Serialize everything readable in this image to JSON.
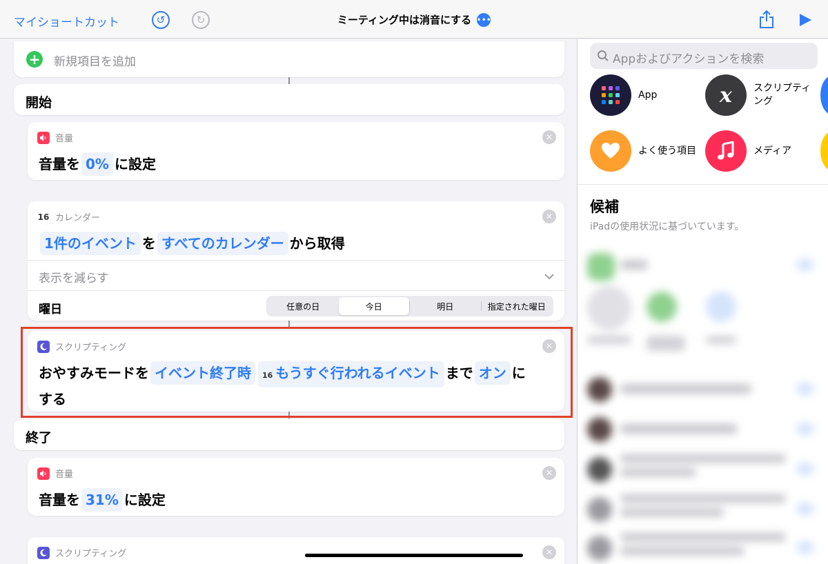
{
  "nav": {
    "back_label": "マイショートカット",
    "title": "ミーティング中は消音にする",
    "more_glyph": "•••",
    "undo_glyph": "↺",
    "redo_glyph": "↻",
    "icons": [
      "undo-icon",
      "redo-icon",
      "share-icon",
      "play-icon"
    ]
  },
  "editor": {
    "add_item_label": "新規項目を追加",
    "start_label": "開始",
    "end_label": "終了",
    "volume1": {
      "action_name": "音量",
      "prefix": "音量を",
      "value": "0%",
      "suffix": "に設定"
    },
    "calendar": {
      "badge": "16",
      "action_name": "カレンダー",
      "token1": "1件のイベント",
      "connector": "を",
      "token2": "すべてのカレンダー",
      "suffix": "から取得",
      "show_less": "表示を減らす",
      "weekday_label": "曜日",
      "segments": [
        "任意の日",
        "今日",
        "明日",
        "指定された曜日"
      ],
      "selected_segment": "今日"
    },
    "scripting1": {
      "action_name": "スクリプティング",
      "prefix": "おやすみモードを",
      "token1": "イベント終了時",
      "token2_badge": "16",
      "token2": "もうすぐ行われるイベント",
      "connector": "まで",
      "token3": "オン",
      "suffix1": "に",
      "suffix2": "する"
    },
    "volume2": {
      "action_name": "音量",
      "prefix": "音量を",
      "value": "31%",
      "suffix": "に設定"
    },
    "scripting2": {
      "action_name": "スクリプティング"
    },
    "close_glyph": "✕"
  },
  "sidebar": {
    "search_placeholder": "Appおよびアクションを検索",
    "categories": [
      {
        "label": "App",
        "icon": "app-grid-icon",
        "color": "#1c1c3a"
      },
      {
        "label": "スクリプティ\nング",
        "icon": "script-x-icon",
        "color": "#3a3a3c"
      },
      {
        "label": "よく使う項目",
        "icon": "heart-icon",
        "color": "#ff9f2e"
      },
      {
        "label": "メディア",
        "icon": "music-note-icon",
        "color": "#ff2d55"
      }
    ],
    "script_glyph": "x",
    "suggestions_title": "候補",
    "suggestions_subtitle": "iPadの使用状況に基づいています。"
  },
  "colors": {
    "accent": "#2f7cf6",
    "highlight_frame": "#e0402b",
    "add_green": "#34c759"
  }
}
